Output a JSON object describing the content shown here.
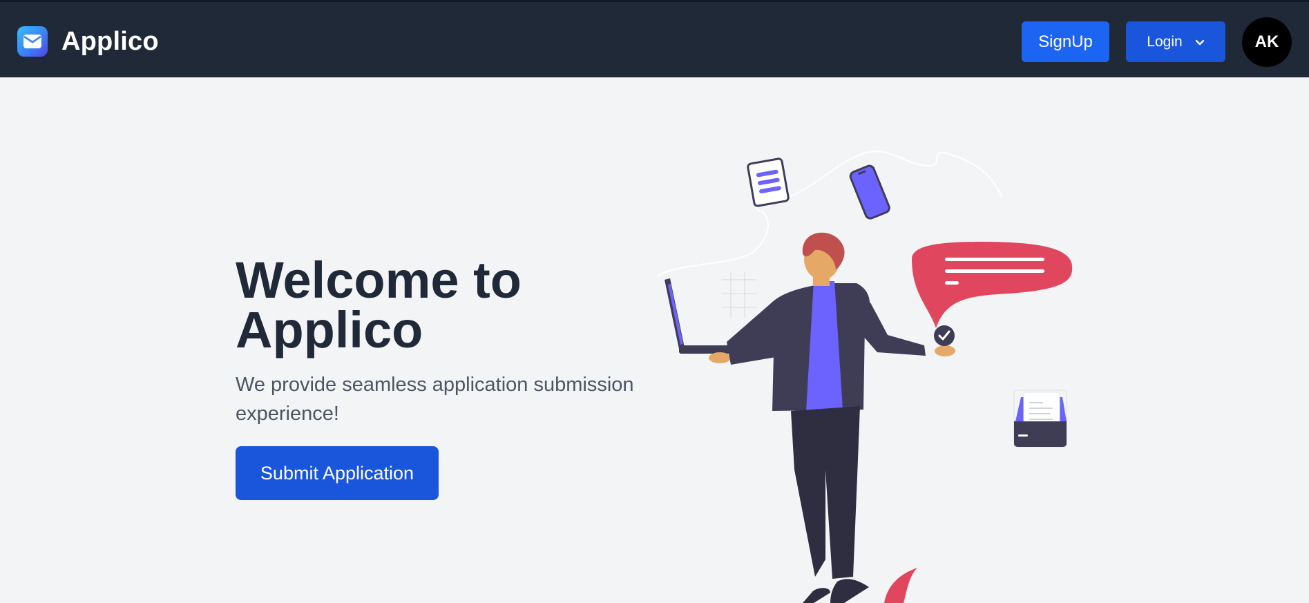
{
  "navbar": {
    "brand_name": "Applico",
    "brand_icon": "envelope-icon",
    "signup_label": "SignUp",
    "login_label": "Login",
    "login_icon": "chevron-down-icon",
    "avatar_initials": "AK"
  },
  "hero": {
    "title": "Welcome to Applico",
    "subtitle": "We provide seamless application submission experience!",
    "cta_label": "Submit Application"
  },
  "colors": {
    "navbar_bg": "#1f2937",
    "page_bg": "#f3f4f6",
    "primary": "#1a56db",
    "accent_purple": "#6c63ff",
    "accent_red": "#e0475e"
  }
}
